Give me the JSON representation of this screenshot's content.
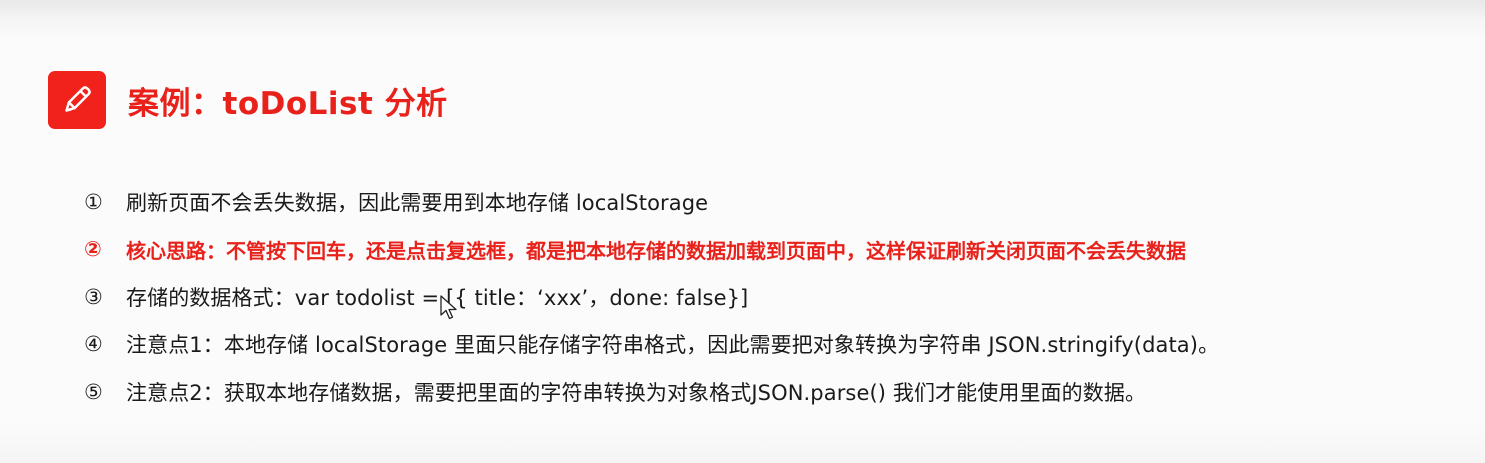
{
  "slide": {
    "title": "案例：toDoList 分析",
    "title_icon": "pencil-icon",
    "accent_color": "#e8211b",
    "items": [
      {
        "num": "①",
        "text": "刷新页面不会丢失数据，因此需要用到本地存储 localStorage",
        "highlight": false
      },
      {
        "num": "②",
        "text": "核心思路：不管按下回车，还是点击复选框，都是把本地存储的数据加载到页面中，这样保证刷新关闭页面不会丢失数据",
        "highlight": true
      },
      {
        "num": "③",
        "text": "存储的数据格式：var todolist =   [{ title：‘xxx’，done: false}]",
        "highlight": false
      },
      {
        "num": "④",
        "text": "注意点1：本地存储 localStorage 里面只能存储字符串格式，因此需要把对象转换为字符串 JSON.stringify(data)。",
        "highlight": false
      },
      {
        "num": "⑤",
        "text": "注意点2：获取本地存储数据，需要把里面的字符串转换为对象格式JSON.parse() 我们才能使用里面的数据。",
        "highlight": false
      }
    ]
  }
}
